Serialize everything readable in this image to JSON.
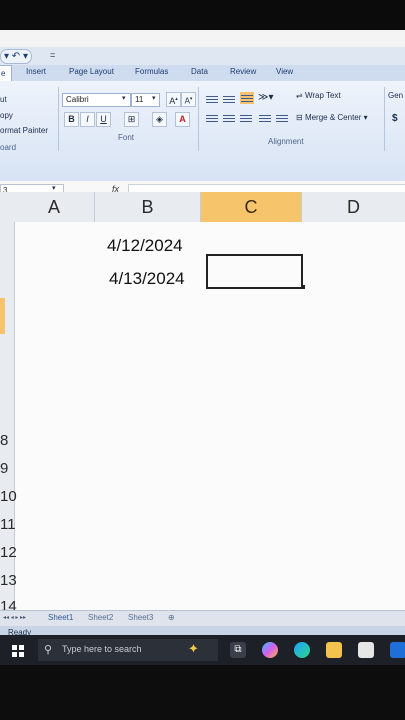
{
  "quick_access": {
    "qat_label": "▾ ↶ ▾",
    "more": "="
  },
  "ribbon": {
    "tabs": [
      {
        "label": "e"
      },
      {
        "label": "Insert"
      },
      {
        "label": "Page Layout"
      },
      {
        "label": "Formulas"
      },
      {
        "label": "Data"
      },
      {
        "label": "Review"
      },
      {
        "label": "View"
      }
    ],
    "clipboard": {
      "cut": "ut",
      "copy": "opy",
      "format_painter": "ormat Painter",
      "group": "oard"
    },
    "font": {
      "name": "Calibri",
      "size": "11",
      "bold": "B",
      "italic": "I",
      "underline": "U",
      "font_color": "A",
      "group": "Font"
    },
    "alignment": {
      "wrap_text": "Wrap Text",
      "merge_center": "Merge & Center",
      "group": "Alignment"
    },
    "number": {
      "format": "Gen",
      "currency": "$"
    }
  },
  "formula_bar": {
    "name_box": "3",
    "fx_label": "fx",
    "value": ""
  },
  "columns": [
    "A",
    "B",
    "C",
    "D"
  ],
  "selected_column": "C",
  "rows": [
    "8",
    "9",
    "10",
    "11",
    "12",
    "13",
    "14"
  ],
  "cells": {
    "b1": "4/12/2024",
    "b2": "4/13/2024"
  },
  "sheets": [
    "Sheet1",
    "Sheet2",
    "Sheet3"
  ],
  "status": "Ready",
  "taskbar": {
    "search_placeholder": "Type here to search"
  },
  "colors": {
    "selection": "#f6c46b",
    "ribbon": "#dfe7f3",
    "taskbar": "#1d2026"
  }
}
